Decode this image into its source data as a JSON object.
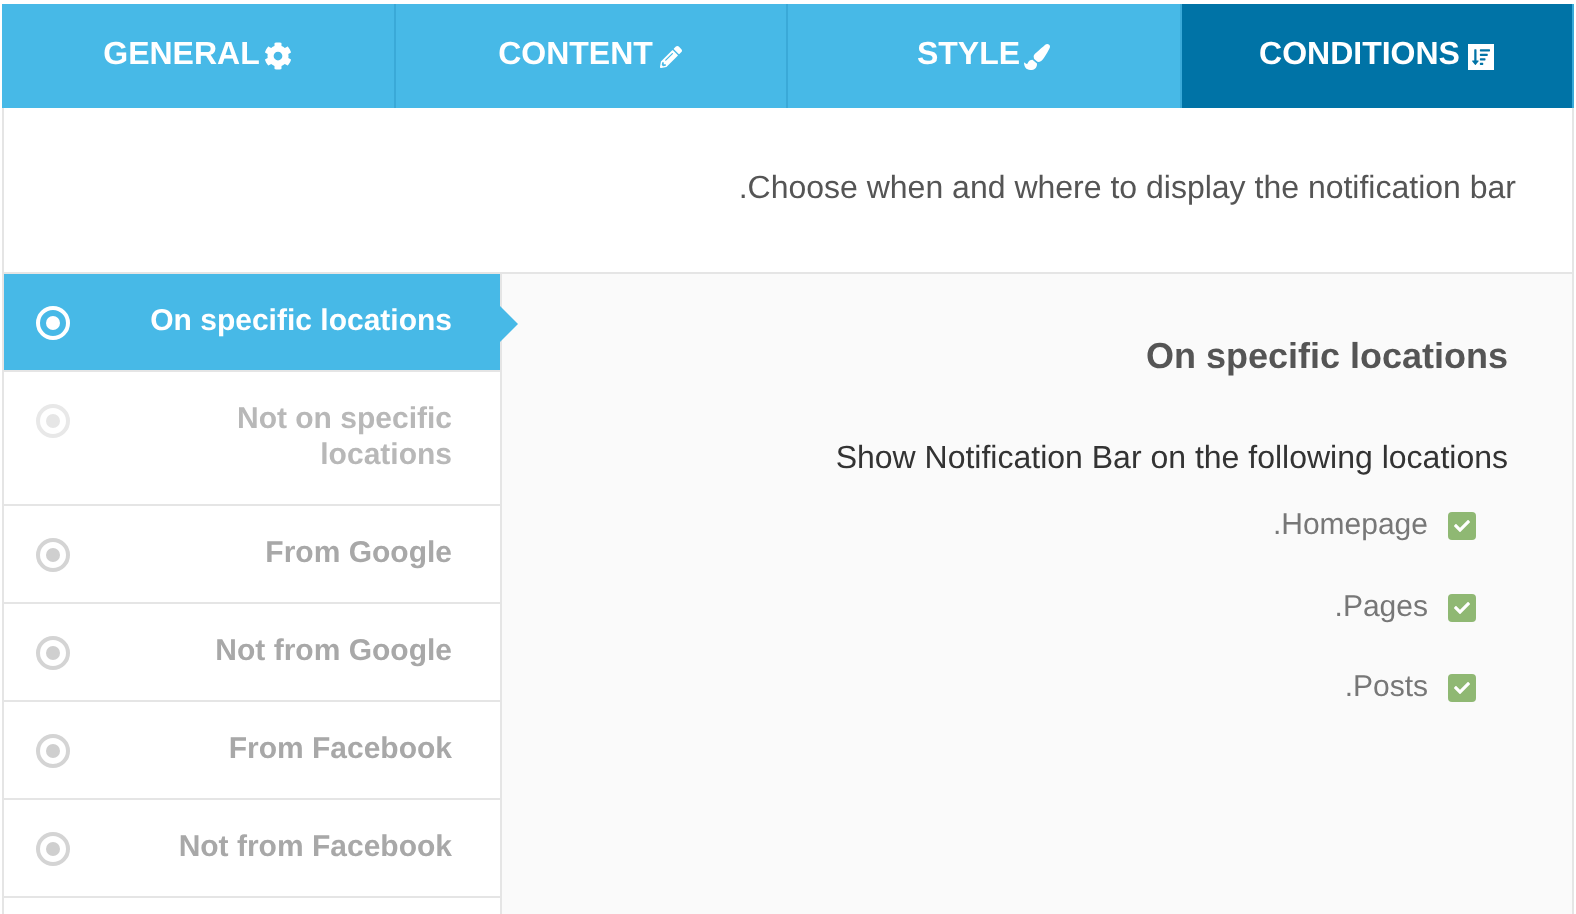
{
  "tabs": [
    {
      "label": "GENERAL",
      "selected": false
    },
    {
      "label": "CONTENT",
      "selected": false
    },
    {
      "label": "STYLE",
      "selected": false
    },
    {
      "label": "CONDITIONS",
      "selected": true
    }
  ],
  "intro": ".Choose when and where to display the notification bar",
  "conditions": [
    {
      "label": "On specific locations",
      "selected": true,
      "disabled": false
    },
    {
      "label": "Not on specific locations",
      "selected": false,
      "disabled": true
    },
    {
      "label": "From Google",
      "selected": false,
      "disabled": false
    },
    {
      "label": "Not from Google",
      "selected": false,
      "disabled": false
    },
    {
      "label": "From Facebook",
      "selected": false,
      "disabled": false
    },
    {
      "label": "Not from Facebook",
      "selected": false,
      "disabled": false
    }
  ],
  "panel": {
    "title": "On specific locations",
    "subtitle": "Show Notification Bar on the following locations",
    "locations": [
      {
        "label": ".Homepage",
        "checked": true
      },
      {
        "label": ".Pages",
        "checked": true
      },
      {
        "label": ".Posts",
        "checked": true
      }
    ]
  }
}
